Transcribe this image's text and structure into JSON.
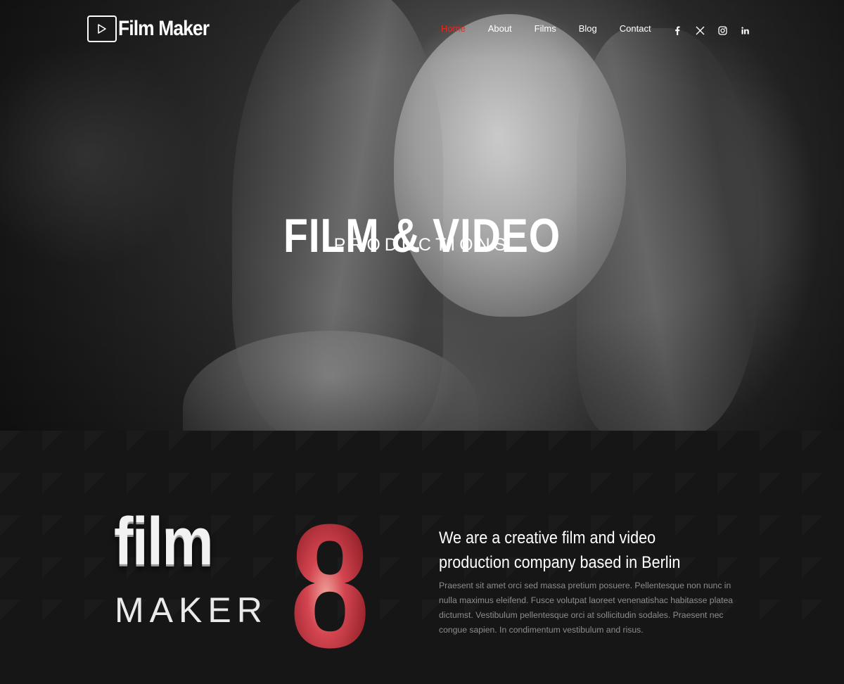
{
  "header": {
    "logo_text": "Film Maker",
    "nav": [
      {
        "label": "Home",
        "active": true
      },
      {
        "label": "About",
        "active": false
      },
      {
        "label": "Films",
        "active": false
      },
      {
        "label": "Blog",
        "active": false
      },
      {
        "label": "Contact",
        "active": false
      }
    ],
    "social_icons": [
      "facebook-icon",
      "x-icon",
      "instagram-icon",
      "linkedin-icon"
    ],
    "accent_color": "#e02b20"
  },
  "hero": {
    "title": "FILM & VIDEO",
    "subtitle": "PRODUCTIONS"
  },
  "about": {
    "graphic_film": "film",
    "graphic_maker": "MAKER",
    "graphic_number": "8",
    "heading": "We are a creative film and video production company based in Berlin",
    "body": "Praesent sit amet orci sed massa pretium posuere. Pellentesque non nunc in nulla maximus eleifend. Fusce volutpat laoreet venenatishac habitasse platea dictumst. Vestibulum pellentesque orci at sollicitudin sodales. Praesent nec congue sapien. In condimentum vestibulum and risus."
  }
}
